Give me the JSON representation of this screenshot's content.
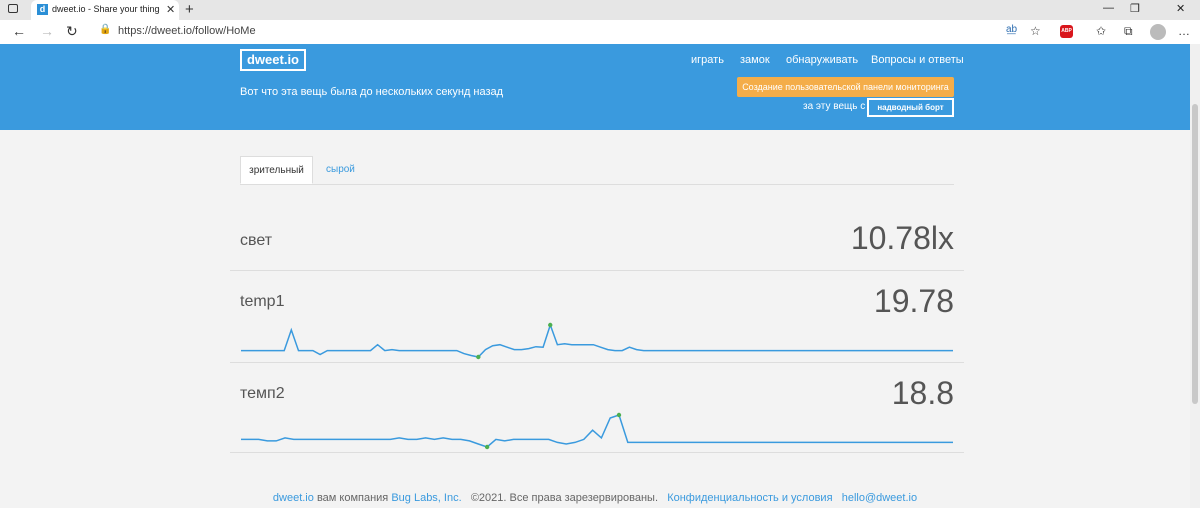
{
  "browser": {
    "tab_title": "dweet.io - Share your thing- like",
    "favicon": "d",
    "url": "https://dweet.io/follow/HoMe",
    "abp_label": "ABP"
  },
  "header": {
    "logo": "dweet.io",
    "tagline": "Вот что эта вещь была до нескольких секунд назад",
    "menu": [
      "играть",
      "замок",
      "обнаруживать",
      "Вопросы и ответы"
    ],
    "dashboard_button": "Создание пользовательской панели мониторинга",
    "for_thing_label": "за эту вещь с",
    "thing_button": "надводный борт"
  },
  "tabs": [
    "зрительный",
    "сырой"
  ],
  "metrics": [
    {
      "name": "свет",
      "value": "10.78lx"
    },
    {
      "name": "temp1",
      "value": "19.78"
    },
    {
      "name": "темп2",
      "value": "18.8"
    }
  ],
  "sparklines": {
    "temp1": [
      19.78,
      19.78,
      19.78,
      19.78,
      19.78,
      19.78,
      19.78,
      20.2,
      19.78,
      19.78,
      19.78,
      19.7,
      19.78,
      19.78,
      19.78,
      19.78,
      19.78,
      19.78,
      19.78,
      19.9,
      19.78,
      19.8,
      19.78,
      19.78,
      19.78,
      19.78,
      19.78,
      19.78,
      19.78,
      19.78,
      19.78,
      19.72,
      19.68,
      19.65,
      19.8,
      19.88,
      19.9,
      19.85,
      19.8,
      19.8,
      19.82,
      19.86,
      19.85,
      20.3,
      19.9,
      19.92,
      19.9,
      19.9,
      19.9,
      19.9,
      19.85,
      19.8,
      19.78,
      19.78,
      19.85,
      19.8,
      19.78,
      19.78,
      19.78,
      19.78,
      19.78,
      19.78,
      19.78,
      19.78,
      19.78,
      19.78,
      19.78,
      19.78,
      19.78,
      19.78,
      19.78,
      19.78,
      19.78,
      19.78,
      19.78,
      19.78,
      19.78,
      19.78,
      19.78,
      19.78,
      19.78,
      19.78,
      19.78,
      19.78,
      19.78,
      19.78,
      19.78,
      19.78,
      19.78,
      19.78,
      19.78,
      19.78,
      19.78,
      19.78,
      19.78,
      19.78,
      19.78,
      19.78,
      19.78,
      19.78
    ],
    "temp2": [
      18.82,
      18.82,
      18.82,
      18.81,
      18.81,
      18.83,
      18.82,
      18.82,
      18.82,
      18.82,
      18.82,
      18.82,
      18.82,
      18.82,
      18.82,
      18.82,
      18.82,
      18.82,
      18.83,
      18.82,
      18.82,
      18.83,
      18.82,
      18.83,
      18.82,
      18.82,
      18.81,
      18.79,
      18.77,
      18.82,
      18.81,
      18.82,
      18.82,
      18.82,
      18.82,
      18.82,
      18.8,
      18.79,
      18.8,
      18.82,
      18.88,
      18.83,
      18.96,
      18.98,
      18.8,
      18.8,
      18.8,
      18.8,
      18.8,
      18.8,
      18.8,
      18.8,
      18.8,
      18.8,
      18.8,
      18.8,
      18.8,
      18.8,
      18.8,
      18.8,
      18.8,
      18.8,
      18.8,
      18.8,
      18.8,
      18.8,
      18.8,
      18.8,
      18.8,
      18.8,
      18.8,
      18.8,
      18.8,
      18.8,
      18.8,
      18.8,
      18.8,
      18.8,
      18.8,
      18.8,
      18.8,
      18.8
    ],
    "line_color": "#3a9ade",
    "marker_color": "#4caf50"
  },
  "footer": {
    "brand": "dweet.io",
    "by": "вам компания",
    "company": "Bug Labs, Inc.",
    "copyright": "©2021. Все права зарезервированы.",
    "privacy": "Конфиденциальность и условия",
    "email": "hello@dweet.io"
  }
}
